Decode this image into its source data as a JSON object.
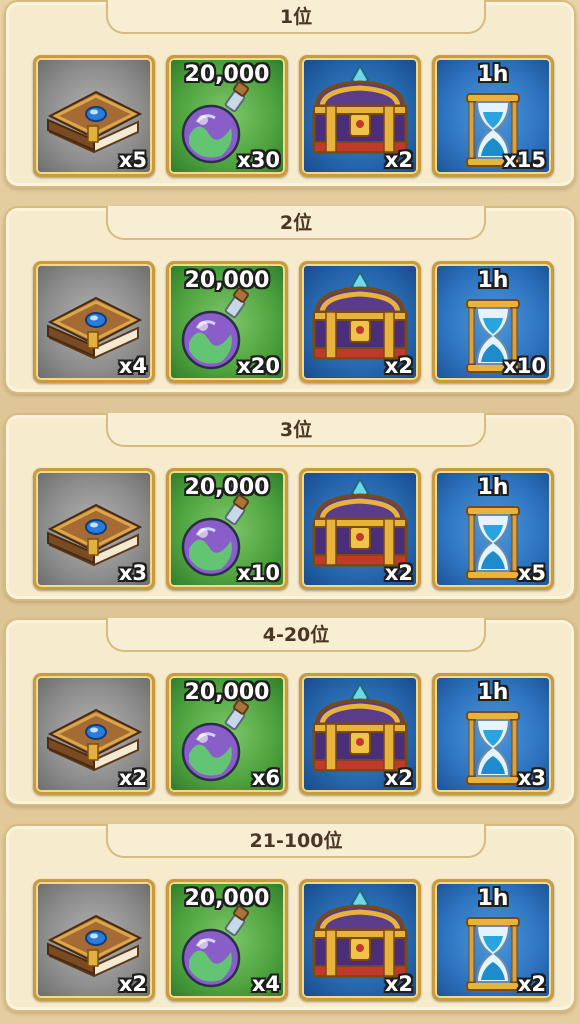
{
  "sections": [
    {
      "rank": "1位",
      "book_qty": "x5",
      "potion_value": "20,000",
      "potion_qty": "x30",
      "chest_qty": "x2",
      "timer_value": "1h",
      "timer_qty": "x15"
    },
    {
      "rank": "2位",
      "book_qty": "x4",
      "potion_value": "20,000",
      "potion_qty": "x20",
      "chest_qty": "x2",
      "timer_value": "1h",
      "timer_qty": "x10"
    },
    {
      "rank": "3位",
      "book_qty": "x3",
      "potion_value": "20,000",
      "potion_qty": "x10",
      "chest_qty": "x2",
      "timer_value": "1h",
      "timer_qty": "x5"
    },
    {
      "rank": "4-20位",
      "book_qty": "x2",
      "potion_value": "20,000",
      "potion_qty": "x6",
      "chest_qty": "x2",
      "timer_value": "1h",
      "timer_qty": "x3"
    },
    {
      "rank": "21-100位",
      "book_qty": "x2",
      "potion_value": "20,000",
      "potion_qty": "x4",
      "chest_qty": "x2",
      "timer_value": "1h",
      "timer_qty": "x2"
    }
  ],
  "icons": {
    "book": "spellbook-icon",
    "potion": "exp-potion-icon",
    "chest": "treasure-chest-icon",
    "timer": "hourglass-icon"
  },
  "colors": {
    "panel": "#f6ebcd",
    "panel_border": "#d6bb83",
    "rank_text": "#4b3524",
    "item_frame": "#c99b3e"
  }
}
